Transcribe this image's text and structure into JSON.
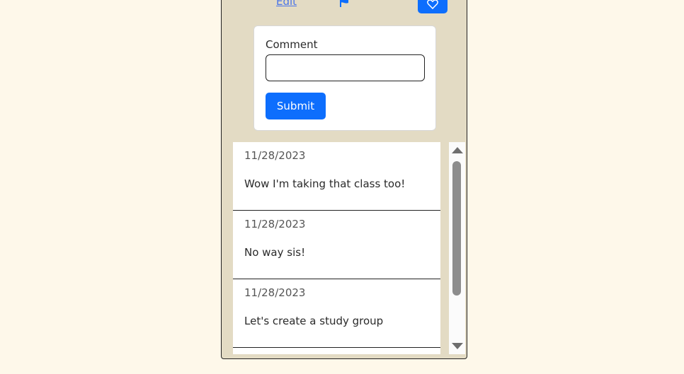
{
  "post_actions": {
    "edit_label": "Edit",
    "flag_icon": "flag-icon",
    "like_icon": "heart-icon"
  },
  "comment_form": {
    "label": "Comment",
    "input_value": "",
    "submit_label": "Submit"
  },
  "comments": [
    {
      "date": "11/28/2023",
      "text": "Wow I'm taking that class too!"
    },
    {
      "date": "11/28/2023",
      "text": "No way sis!"
    },
    {
      "date": "11/28/2023",
      "text": "Let's create a study group"
    }
  ],
  "colors": {
    "page_background": "#fef8ea",
    "card_background": "#e3dbc4",
    "accent": "#0d6efd"
  }
}
